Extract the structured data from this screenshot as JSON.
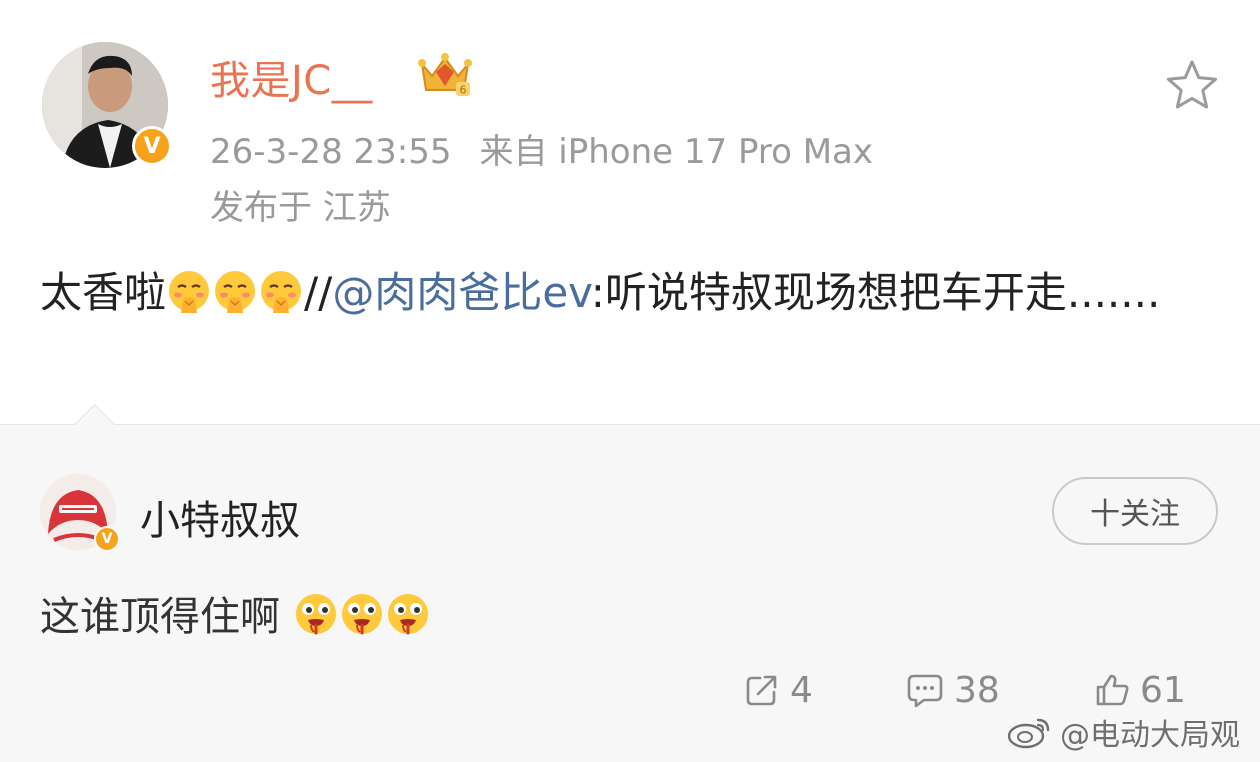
{
  "post": {
    "username": "我是JC__",
    "timestamp": "26-3-28 23:55",
    "source": "来自 iPhone 17 Pro Max",
    "location": "发布于 江苏",
    "text_prefix": "太香啦",
    "separator": "//",
    "mention": "@肉肉爸比ev",
    "text_suffix": ":听说特叔现场想把车开走.......",
    "emoji": "shy-face-emoji"
  },
  "repost": {
    "username": "小特叔叔",
    "follow_label": "十关注",
    "text": "这谁顶得住啊",
    "emoji": "drooling-face-emoji"
  },
  "actions": {
    "reposts": "4",
    "comments": "38",
    "likes": "61"
  },
  "watermark": "@电动大局观",
  "colors": {
    "username": "#eb7350",
    "mention": "#4a6d9e",
    "verified_badge": "#f7a21b",
    "meta_text": "#9a9a9a"
  },
  "badges": {
    "post_author_verified": "V",
    "repost_author_verified": "V"
  }
}
